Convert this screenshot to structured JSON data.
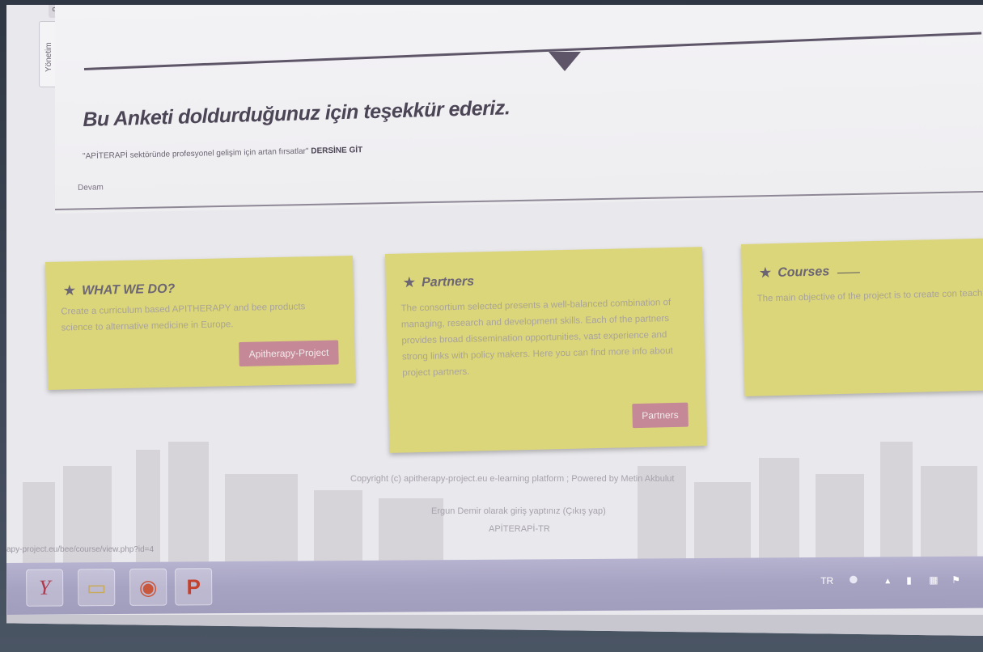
{
  "side_tab": {
    "label": "Yönetim",
    "top_label": "o"
  },
  "main": {
    "thanks_heading": "Bu Anketi doldurduğunuz için teşekkür ederiz.",
    "course_text": "\"APİTERAPİ sektöründe profesyonel gelişim için artan fırsatlar\"",
    "course_link": "DERSİNE GİT",
    "continue_label": "Devam"
  },
  "cards": [
    {
      "title": "WHAT WE DO?",
      "text": "Create a curriculum based APITHERAPY and bee products science to alternative medicine in Europe.",
      "button": "Apitherapy-Project"
    },
    {
      "title": "Partners",
      "text": "The consortium selected presents a well-balanced combination of managing, research and development skills. Each of the partners provides broad dissemination opportunities, vast experience and strong links with policy makers. Here you can find more info about project partners.",
      "button": "Partners"
    },
    {
      "title": "Courses",
      "text": "The main objective of the project is to create con teaching materials on bee products in alternative"
    }
  ],
  "footer": {
    "copyright": "Copyright (c) apitherapy-project.eu e-learning platform ; Powered by Metin Akbulut",
    "guest": "Ergun Demir olarak giriş yaptınız (Çıkış yap)",
    "lang": "APİTERAPİ-TR"
  },
  "status_url": "apy-project.eu/bee/course/view.php?id=4",
  "taskbar": {
    "apps": [
      {
        "icon": "yandex-browser-icon",
        "glyph": "Y"
      },
      {
        "icon": "file-explorer-icon",
        "glyph": "▭"
      },
      {
        "icon": "chrome-icon",
        "glyph": "◉"
      },
      {
        "icon": "powerpoint-icon",
        "glyph": "P"
      }
    ],
    "language": "TR"
  },
  "colors": {
    "card_yellow": "#dcd67a",
    "button_pink": "#c48896",
    "heading_text": "#4c4556",
    "taskbar": "#a6a2c2"
  }
}
